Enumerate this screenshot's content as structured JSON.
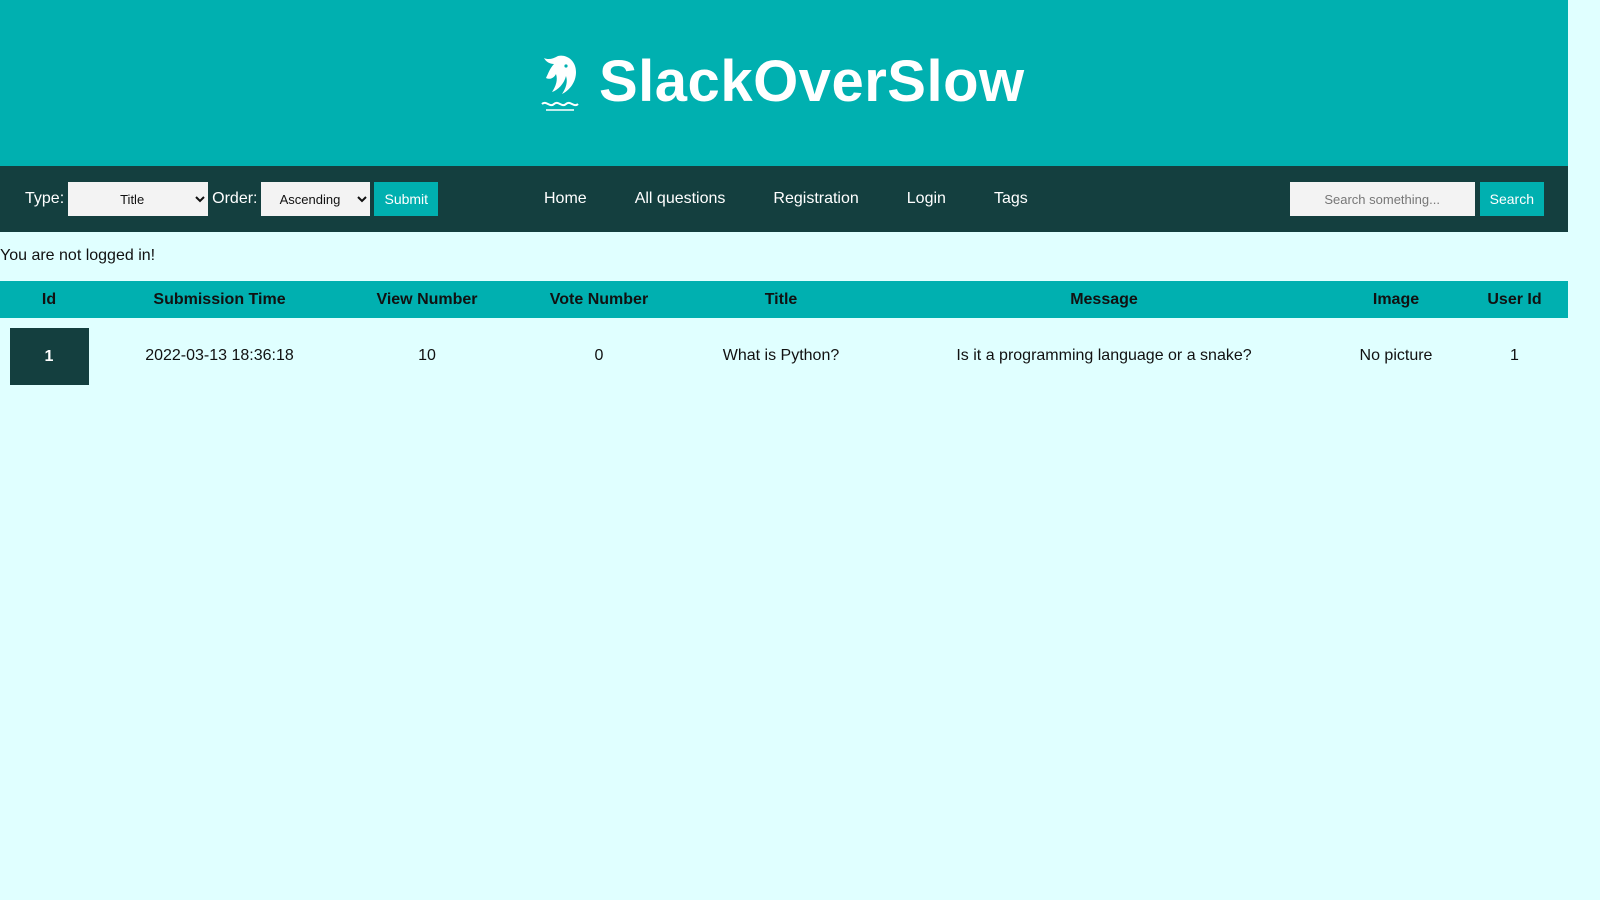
{
  "header": {
    "title": "SlackOverSlow",
    "logo_icon": "dolphin-icon"
  },
  "filter": {
    "type_label": "Type:",
    "type_selected": "Title",
    "order_label": "Order:",
    "order_selected": "Ascending",
    "submit_label": "Submit"
  },
  "nav": {
    "items": [
      {
        "label": "Home"
      },
      {
        "label": "All questions"
      },
      {
        "label": "Registration"
      },
      {
        "label": "Login"
      },
      {
        "label": "Tags"
      }
    ]
  },
  "search": {
    "placeholder": "Search something...",
    "button_label": "Search"
  },
  "status": {
    "message": "You are not logged in!"
  },
  "table": {
    "headers": [
      "Id",
      "Submission Time",
      "View Number",
      "Vote Number",
      "Title",
      "Message",
      "Image",
      "User Id"
    ],
    "rows": [
      {
        "id": "1",
        "submission_time": "2022-03-13 18:36:18",
        "view_number": "10",
        "vote_number": "0",
        "title": "What is Python?",
        "message": "Is it a programming language or a snake?",
        "image": "No picture",
        "user_id": "1"
      }
    ]
  },
  "colors": {
    "header_bg": "#00b0b0",
    "nav_bg": "#143f3f",
    "page_bg": "#e0ffff",
    "accent": "#00b0b0"
  }
}
